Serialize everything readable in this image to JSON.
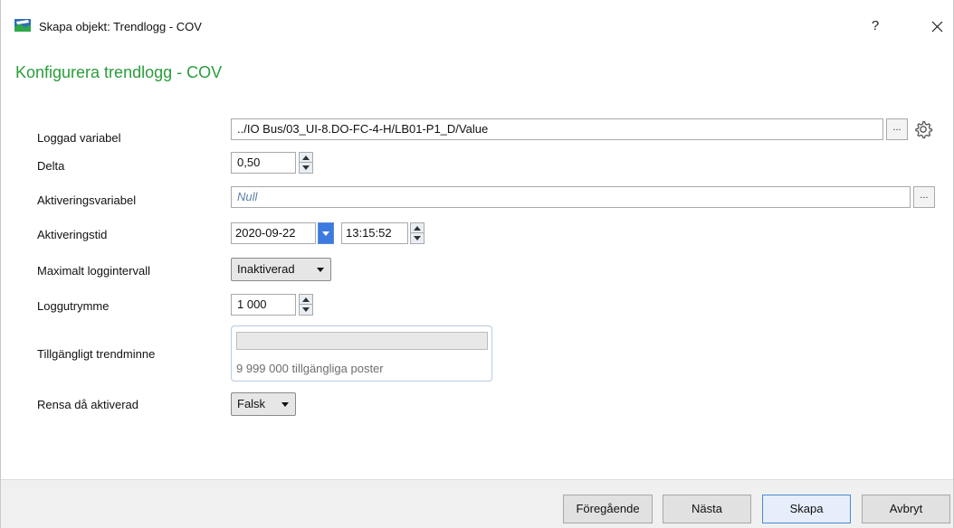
{
  "window": {
    "title": "Skapa objekt: Trendlogg - COV",
    "help_label": "?",
    "heading": "Konfigurera trendlogg - COV"
  },
  "form": {
    "logged_variable": {
      "label": "Loggad variabel",
      "value": "../IO Bus/03_UI-8.DO-FC-4-H/LB01-P1_D/Value",
      "browse_label": "..."
    },
    "delta": {
      "label": "Delta",
      "value": "0,50"
    },
    "activation_variable": {
      "label": "Aktiveringsvariabel",
      "value": "Null",
      "browse_label": "..."
    },
    "activation_time": {
      "label": "Aktiveringstid",
      "date": "2020-09-22",
      "time": "13:15:52"
    },
    "max_log_interval": {
      "label": "Maximalt loggintervall",
      "value": "Inaktiverad"
    },
    "log_space": {
      "label": "Loggutrymme",
      "value": "1 000"
    },
    "trend_memory": {
      "label": "Tillgängligt trendminne",
      "used_fraction": 0.0,
      "text": "9 999 000 tillgängliga poster"
    },
    "clear_on_activation": {
      "label": "Rensa då aktiverad",
      "value": "Falsk"
    }
  },
  "footer": {
    "previous_label": "Föregående",
    "next_label": "Nästa",
    "create_label": "Skapa",
    "cancel_label": "Avbryt"
  },
  "colors": {
    "heading": "#2a9d3b",
    "primary_border": "#4a8bd6",
    "date_dropdown": "#3c7ae0"
  },
  "icons": {
    "app": "app-icon",
    "help": "help-icon",
    "close": "close-icon",
    "settings": "gear-icon",
    "spin": "spinner-arrows-icon",
    "dropdown": "chevron-down-icon"
  }
}
